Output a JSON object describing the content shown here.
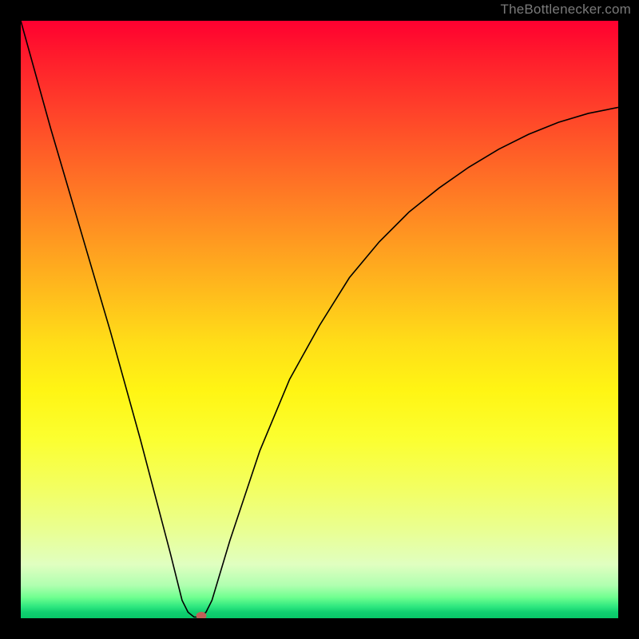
{
  "watermark": "TheBottlenecker.com",
  "chart_data": {
    "type": "line",
    "title": "",
    "xlabel": "",
    "ylabel": "",
    "xlim": [
      0,
      100
    ],
    "ylim": [
      0,
      100
    ],
    "x": [
      0,
      5,
      10,
      15,
      20,
      25,
      27,
      28,
      29,
      30,
      31,
      32,
      35,
      40,
      45,
      50,
      55,
      60,
      65,
      70,
      75,
      80,
      85,
      90,
      95,
      100
    ],
    "values": [
      100,
      82,
      65,
      48,
      30,
      11,
      3,
      1,
      0.2,
      0.2,
      1,
      3,
      13,
      28,
      40,
      49,
      57,
      63,
      68,
      72,
      75.5,
      78.5,
      81,
      83,
      84.5,
      85.5
    ],
    "marker": {
      "x": 30.2,
      "y": 0.4
    },
    "background_gradient": {
      "orientation": "vertical",
      "stops": [
        {
          "pos": 0.0,
          "color": "#ff0030"
        },
        {
          "pos": 0.5,
          "color": "#ffd018"
        },
        {
          "pos": 0.8,
          "color": "#f0ff70"
        },
        {
          "pos": 0.97,
          "color": "#60f090"
        },
        {
          "pos": 1.0,
          "color": "#08c868"
        }
      ]
    }
  }
}
